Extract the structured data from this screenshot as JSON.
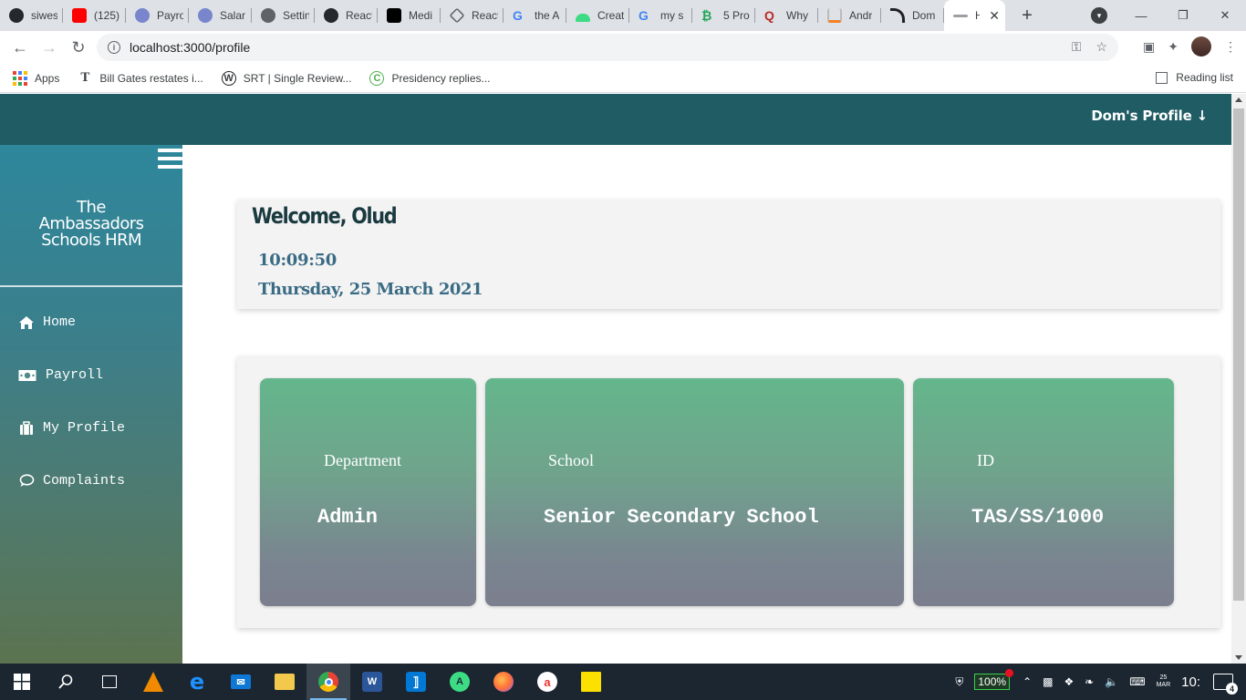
{
  "browser": {
    "tabs": [
      {
        "label": "siwes",
        "icon": "github-icon",
        "color": "#24292e"
      },
      {
        "label": "(125)",
        "icon": "youtube-icon",
        "color": "#ff0000"
      },
      {
        "label": "Payro",
        "icon": "globe-icon",
        "color": "#5c6bc0"
      },
      {
        "label": "Salar",
        "icon": "globe-icon",
        "color": "#5c6bc0"
      },
      {
        "label": "Settin",
        "icon": "globe-icon",
        "color": "#5f6368"
      },
      {
        "label": "React",
        "icon": "github-icon",
        "color": "#24292e"
      },
      {
        "label": "Medi",
        "icon": "medium-icon",
        "color": "#000000"
      },
      {
        "label": "React",
        "icon": "diamond-icon",
        "color": "#5f6368"
      },
      {
        "label": "the A",
        "icon": "google-icon",
        "color": "#4285f4"
      },
      {
        "label": "Creat",
        "icon": "android-icon",
        "color": "#3ddc84"
      },
      {
        "label": "my s",
        "icon": "google-icon",
        "color": "#4285f4"
      },
      {
        "label": "5 Pro",
        "icon": "bitcoin-icon",
        "color": "#26a65b"
      },
      {
        "label": "Why",
        "icon": "quora-icon",
        "color": "#b92b27"
      },
      {
        "label": "Andr",
        "icon": "stackoverflow-icon",
        "color": "#f48024"
      },
      {
        "label": "Dom",
        "icon": "rss-icon",
        "color": "#202124"
      },
      {
        "label": "H",
        "icon": "page-icon",
        "color": "#9aa0a6"
      }
    ],
    "url": "localhost:3000/profile",
    "bookmarks": [
      {
        "label": "Apps"
      },
      {
        "label": "Bill Gates restates i...",
        "icon": "T"
      },
      {
        "label": "SRT | Single Review...",
        "icon": "W"
      },
      {
        "label": "Presidency replies...",
        "icon": "C"
      }
    ],
    "reading_list": "Reading list"
  },
  "app": {
    "profile_menu": "Dom's Profile ↓",
    "brand": [
      "The",
      "Ambassadors",
      "Schools HRM"
    ],
    "nav": [
      {
        "label": "Home",
        "icon": "home-icon"
      },
      {
        "label": "Payroll",
        "icon": "money-icon"
      },
      {
        "label": "My Profile",
        "icon": "briefcase-icon"
      },
      {
        "label": "Complaints",
        "icon": "comment-icon"
      }
    ],
    "welcome": "Welcome, Olud",
    "time": "10:09:50",
    "date": "Thursday, 25 March 2021",
    "cards": [
      {
        "label": "Department",
        "value": "Admin"
      },
      {
        "label": "School",
        "value": "Senior Secondary School"
      },
      {
        "label": "ID",
        "value": "TAS/SS/1000"
      }
    ]
  },
  "taskbar": {
    "battery": "100%",
    "date_short": "25\nMAR",
    "clock": "10:",
    "notifications": "4"
  }
}
